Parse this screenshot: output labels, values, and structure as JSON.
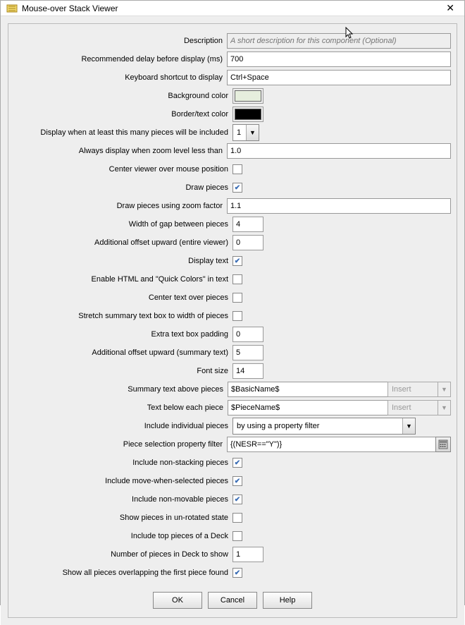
{
  "window": {
    "title": "Mouse-over Stack Viewer"
  },
  "fields": {
    "description": {
      "label": "Description",
      "placeholder": "A short description for this component (Optional)",
      "value": ""
    },
    "delay": {
      "label": "Recommended delay before display (ms)",
      "value": "700"
    },
    "shortcut": {
      "label": "Keyboard shortcut to display",
      "value": "Ctrl+Space"
    },
    "bgcolor": {
      "label": "Background color",
      "value": "#e6eedd"
    },
    "bordercolor": {
      "label": "Border/text color",
      "value": "#000000"
    },
    "minpieces": {
      "label": "Display when at least this many pieces will be included",
      "value": "1"
    },
    "zoomless": {
      "label": "Always display when zoom level less than",
      "value": "1.0"
    },
    "centermouse": {
      "label": "Center viewer over mouse position",
      "checked": false
    },
    "drawpieces": {
      "label": "Draw pieces",
      "checked": true
    },
    "zoomfactor": {
      "label": "Draw pieces using zoom factor",
      "value": "1.1"
    },
    "gap": {
      "label": "Width of gap between pieces",
      "value": "4"
    },
    "offsetviewer": {
      "label": "Additional offset upward (entire viewer)",
      "value": "0"
    },
    "displaytext": {
      "label": "Display text",
      "checked": true
    },
    "enablehtml": {
      "label": "Enable HTML and \"Quick Colors\" in text",
      "checked": false
    },
    "centertext": {
      "label": "Center text over pieces",
      "checked": false
    },
    "stretchtext": {
      "label": "Stretch summary text box to width of pieces",
      "checked": false
    },
    "extrapadding": {
      "label": "Extra text box padding",
      "value": "0"
    },
    "offsetsummary": {
      "label": "Additional offset upward (summary text)",
      "value": "5"
    },
    "fontsize": {
      "label": "Font size",
      "value": "14"
    },
    "summaryabove": {
      "label": "Summary text above pieces",
      "value": "$BasicName$",
      "insert": "Insert"
    },
    "textbelow": {
      "label": "Text below each piece",
      "value": "$PieceName$",
      "insert": "Insert"
    },
    "includeindiv": {
      "label": "Include individual pieces",
      "value": "by using a property filter"
    },
    "propfilter": {
      "label": "Piece selection property filter",
      "value": "{(NESR==\"Y\")}"
    },
    "nonstacking": {
      "label": "Include non-stacking pieces",
      "checked": true
    },
    "movewhensel": {
      "label": "Include move-when-selected pieces",
      "checked": true
    },
    "nonmovable": {
      "label": "Include non-movable pieces",
      "checked": true
    },
    "unrotated": {
      "label": "Show pieces in un-rotated state",
      "checked": false
    },
    "topdeck": {
      "label": "Include top pieces of a Deck",
      "checked": false
    },
    "numdeck": {
      "label": "Number of pieces in Deck to show",
      "value": "1"
    },
    "showoverlap": {
      "label": "Show all pieces overlapping the first piece found",
      "checked": true
    }
  },
  "buttons": {
    "ok": "OK",
    "cancel": "Cancel",
    "help": "Help"
  }
}
